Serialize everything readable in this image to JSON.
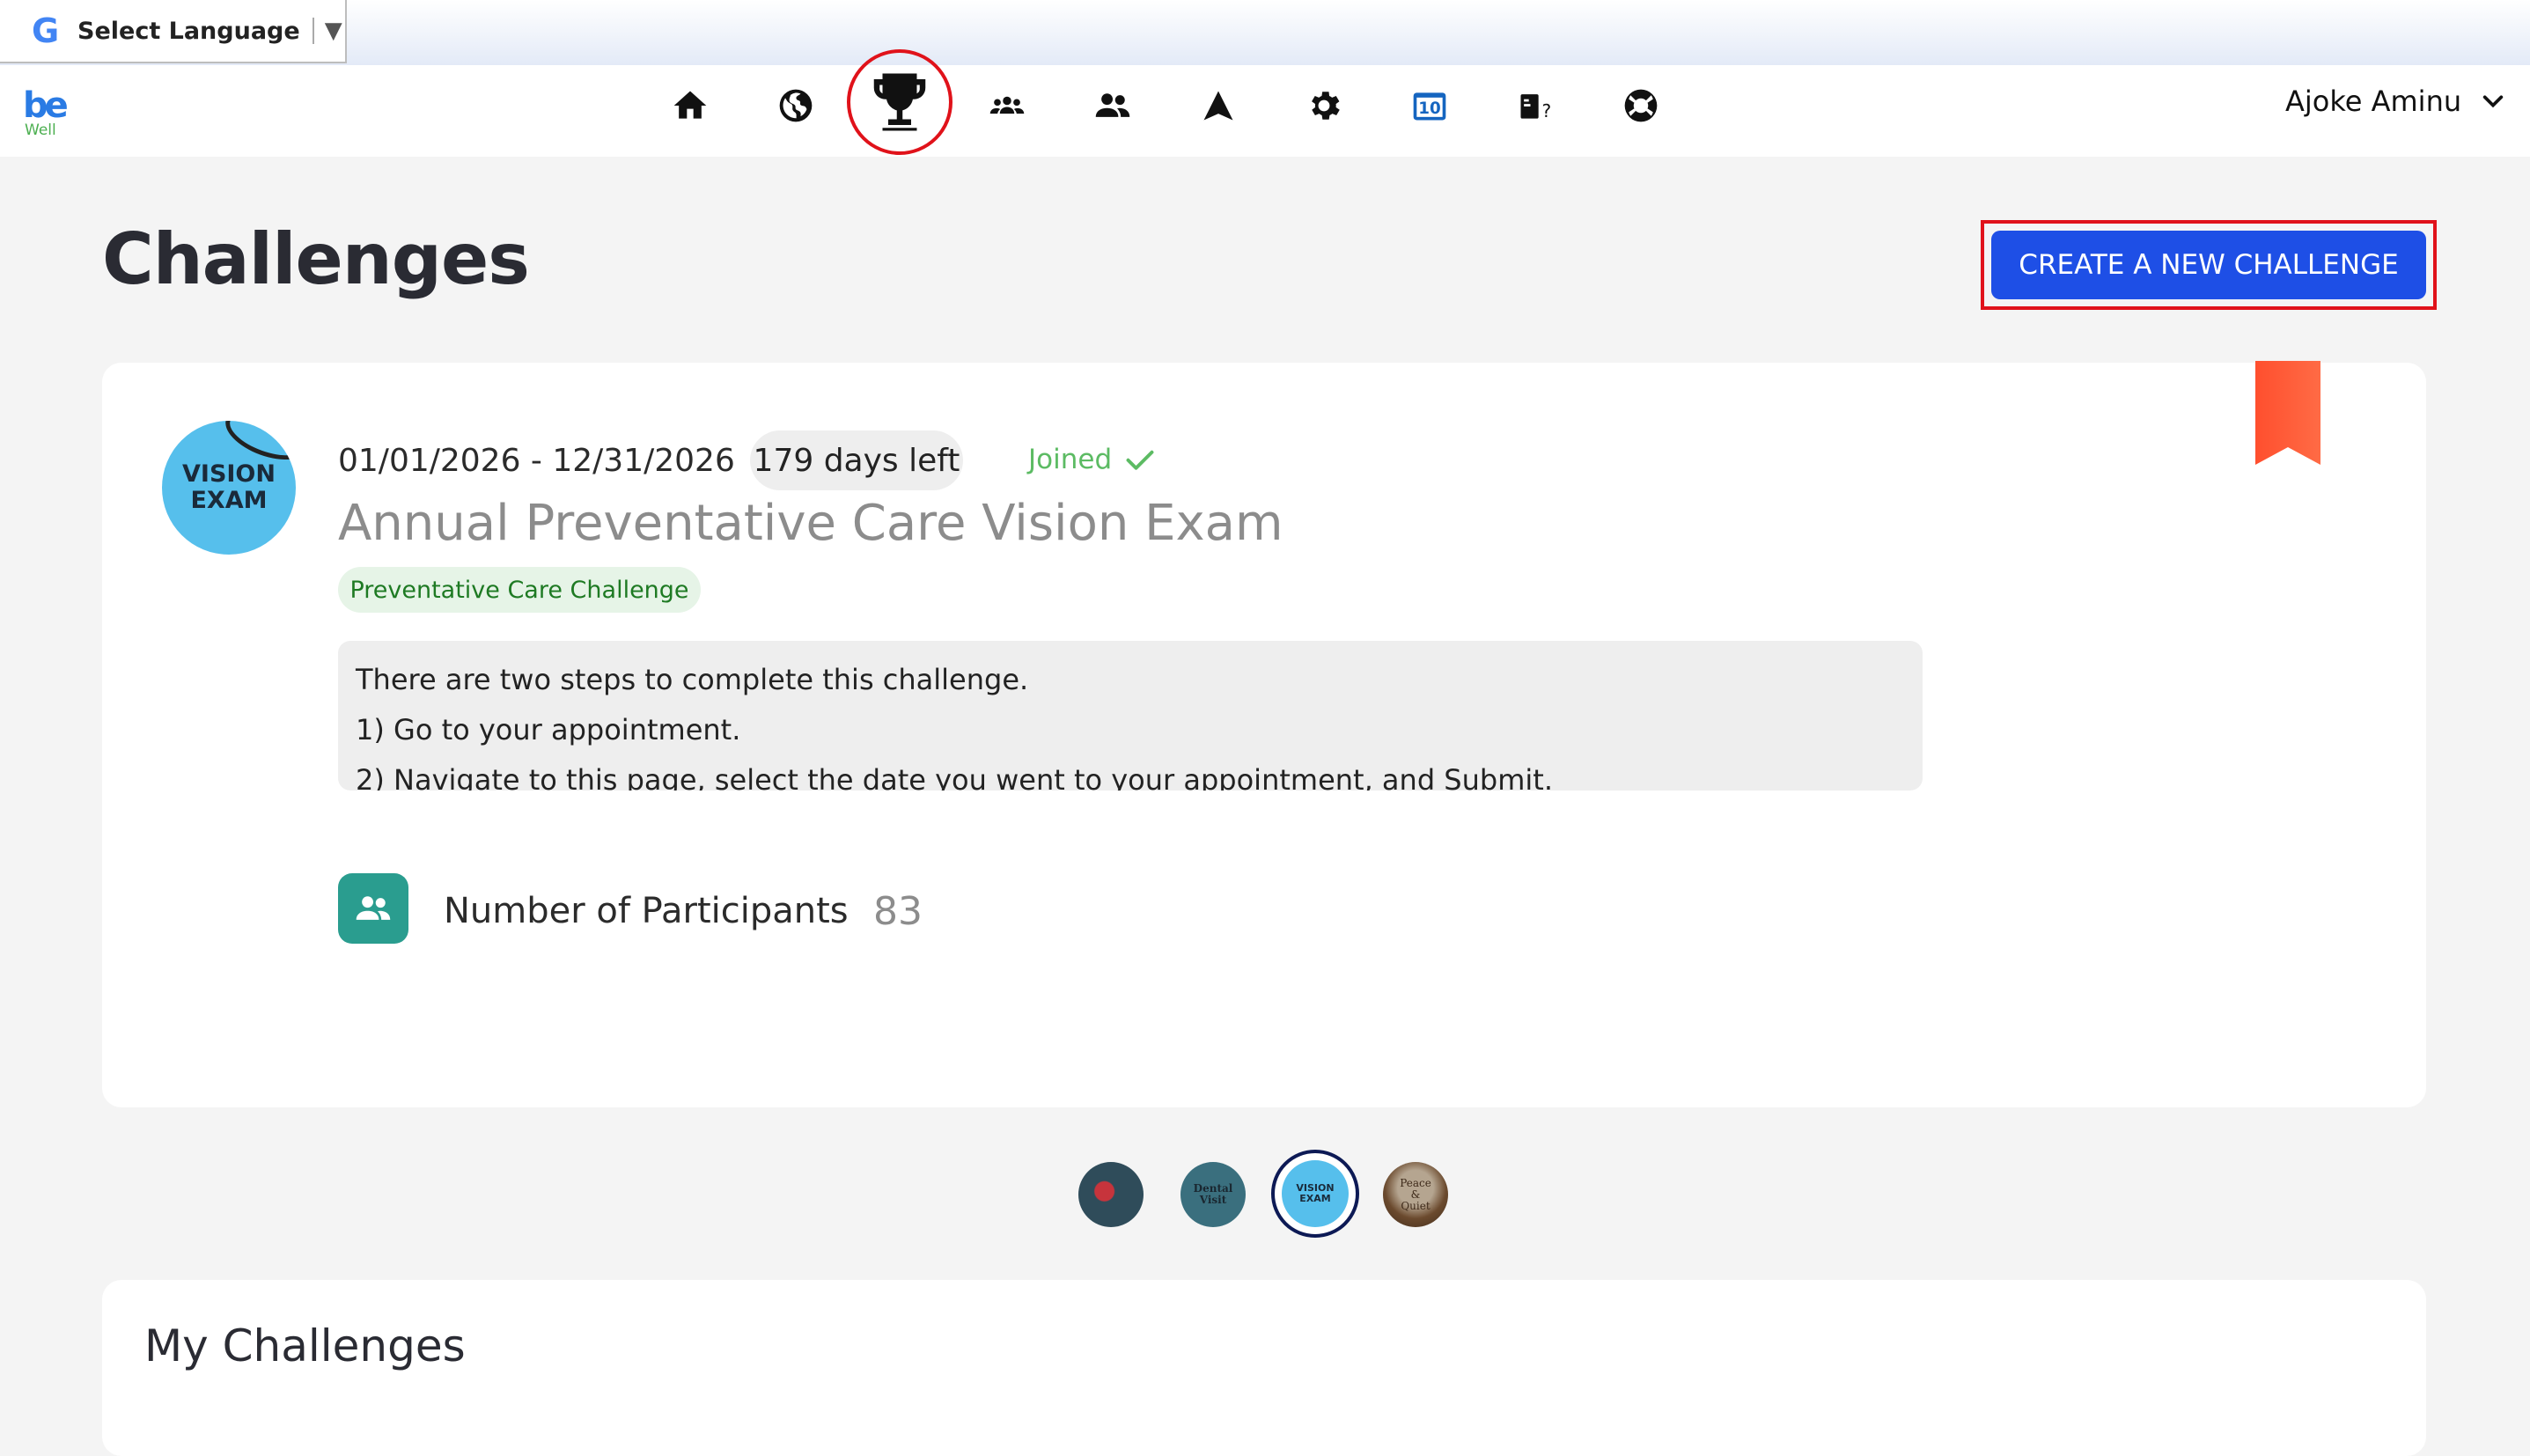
{
  "translate_bar": {
    "label": "Select Language",
    "arrow": "▼",
    "icon": "google-g-icon"
  },
  "nav": {
    "logo_text": "be",
    "logo_sub": "Well",
    "icons": [
      "home-icon",
      "globe-icon",
      "trophy-icon",
      "group-icon",
      "users-icon",
      "arrow-up-icon",
      "gear-icon",
      "calendar-10-icon",
      "quiz-icon",
      "lifebuoy-icon"
    ],
    "active": "trophy-icon",
    "calendar_badge": "10",
    "user_name": "Ajoke Aminu"
  },
  "header": {
    "title": "Challenges",
    "create_button": "CREATE A NEW CHALLENGE"
  },
  "challenge": {
    "avatar_text_line1": "VISION",
    "avatar_text_line2": "EXAM",
    "date_range": "01/01/2026 - 12/31/2026",
    "days_left": "179 days left",
    "status": "Joined",
    "title": "Annual Preventative Care Vision Exam",
    "category": "Preventative Care Challenge",
    "description": [
      "There are two steps to complete this challenge.",
      "1) Go to your appointment.",
      "2) Navigate to this page, select the date you went to your appointment, and Submit."
    ],
    "participants_label": "Number of Participants",
    "participants_count": "83"
  },
  "carousel": {
    "items": [
      {
        "label": ""
      },
      {
        "label": "Dental Visit"
      },
      {
        "label": "VISION EXAM"
      },
      {
        "label": "Peace & Quiet"
      }
    ],
    "active_index": 2
  },
  "my_challenges": {
    "title": "My Challenges"
  },
  "colors": {
    "primary": "#1e4fe6",
    "highlight": "#e0121a",
    "joined": "#5cbb63",
    "teal": "#2a9d8f",
    "bookmark": "#ff5a36"
  }
}
